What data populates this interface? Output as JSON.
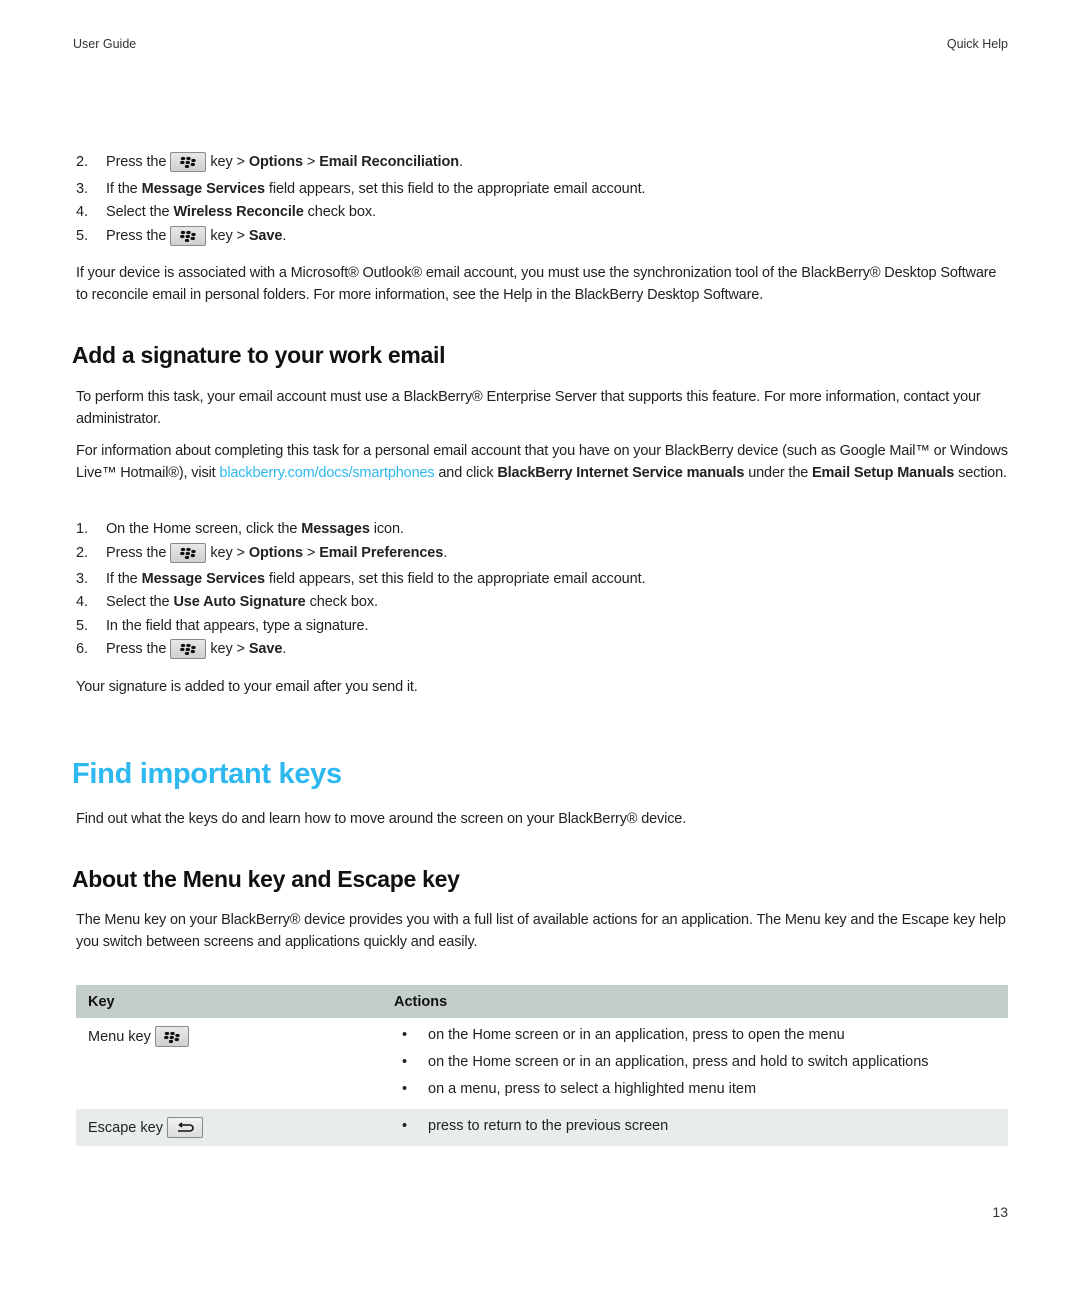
{
  "running_header": {
    "left": "User Guide",
    "right": "Quick Help"
  },
  "reconcile_steps": [
    {
      "num": "2.",
      "pre": "Press the",
      "key_icon": "blackberry-menu-key-icon",
      "post": "key >",
      "b1": "Options",
      "sep": ">",
      "b2": "Email Reconciliation",
      "end": "."
    },
    {
      "num": "3.",
      "pre": "If the",
      "b1": "Message Services",
      "post": "field appears, set this field to the appropriate email account."
    },
    {
      "num": "4.",
      "pre": "Select the",
      "b1": "Wireless Reconcile",
      "post": "check box."
    },
    {
      "num": "5.",
      "pre": "Press the",
      "key_icon": "blackberry-menu-key-icon",
      "post": "key >",
      "b1": "Save",
      "end": "."
    }
  ],
  "outlook_note": "If your device is associated with a Microsoft® Outlook® email account, you must use the synchronization tool of the BlackBerry® Desktop Software to reconcile email in personal folders. For more information, see the Help in the BlackBerry Desktop Software.",
  "signature_section": {
    "heading": "Add a signature to your work email",
    "intro": "To perform this task, your email account must use a BlackBerry® Enterprise Server that supports this feature. For more information, contact your administrator.",
    "personal_note": {
      "pre": "For information about completing this task for a personal email account that you have on your BlackBerry device (such as Google Mail™ or Windows Live™ Hotmail®), visit ",
      "link": "blackberry.com/docs/smartphones",
      "mid": " and click ",
      "b1": "BlackBerry Internet Service manuals",
      "mid2": " under the ",
      "b2": "Email Setup Manuals",
      "end": " section."
    },
    "steps": [
      {
        "num": "1.",
        "pre": "On the Home screen, click the",
        "b1": "Messages",
        "post": "icon."
      },
      {
        "num": "2.",
        "pre": "Press the",
        "post": "key >",
        "b1": "Options",
        "sep": ">",
        "b2": "Email Preferences",
        "end": "."
      },
      {
        "num": "3.",
        "pre": "If the",
        "b1": "Message Services",
        "post": "field appears, set this field to the appropriate email account."
      },
      {
        "num": "4.",
        "pre": "Select the",
        "b1": "Use Auto Signature",
        "post": "check box."
      },
      {
        "num": "5.",
        "pre": "In the field that appears, type a signature."
      },
      {
        "num": "6.",
        "pre": "Press the",
        "post": "key >",
        "b1": "Save",
        "end": "."
      }
    ],
    "result": "Your signature is added to your email after you send it."
  },
  "keys_chapter": {
    "title": "Find important keys",
    "intro": "Find out what the keys do and learn how to move around the screen on your BlackBerry® device."
  },
  "menu_escape_section": {
    "heading": "About the Menu key and Escape key",
    "intro": "The Menu key on your BlackBerry® device provides you with a full list of available actions for an application. The Menu key and the Escape key help you switch between screens and applications quickly and easily.",
    "table": {
      "headers": [
        "Key",
        "Actions"
      ],
      "rows": [
        {
          "key": "Menu key",
          "icon": "blackberry-menu-key-icon",
          "actions": [
            "on the Home screen or in an application, press to open the menu",
            "on the Home screen or in an application, press and hold to switch applications",
            "on a menu, press to select a highlighted menu item"
          ]
        },
        {
          "key": "Escape key",
          "icon": "escape-back-arrow-icon",
          "actions": [
            "press to return to the previous screen"
          ]
        }
      ]
    }
  },
  "bullet_char": "•",
  "page_number": "13",
  "colors": {
    "accent": "#2eb8f0",
    "table_header_bg": "#c3cdcc",
    "table_alt_row_bg": "#e9ecec"
  }
}
